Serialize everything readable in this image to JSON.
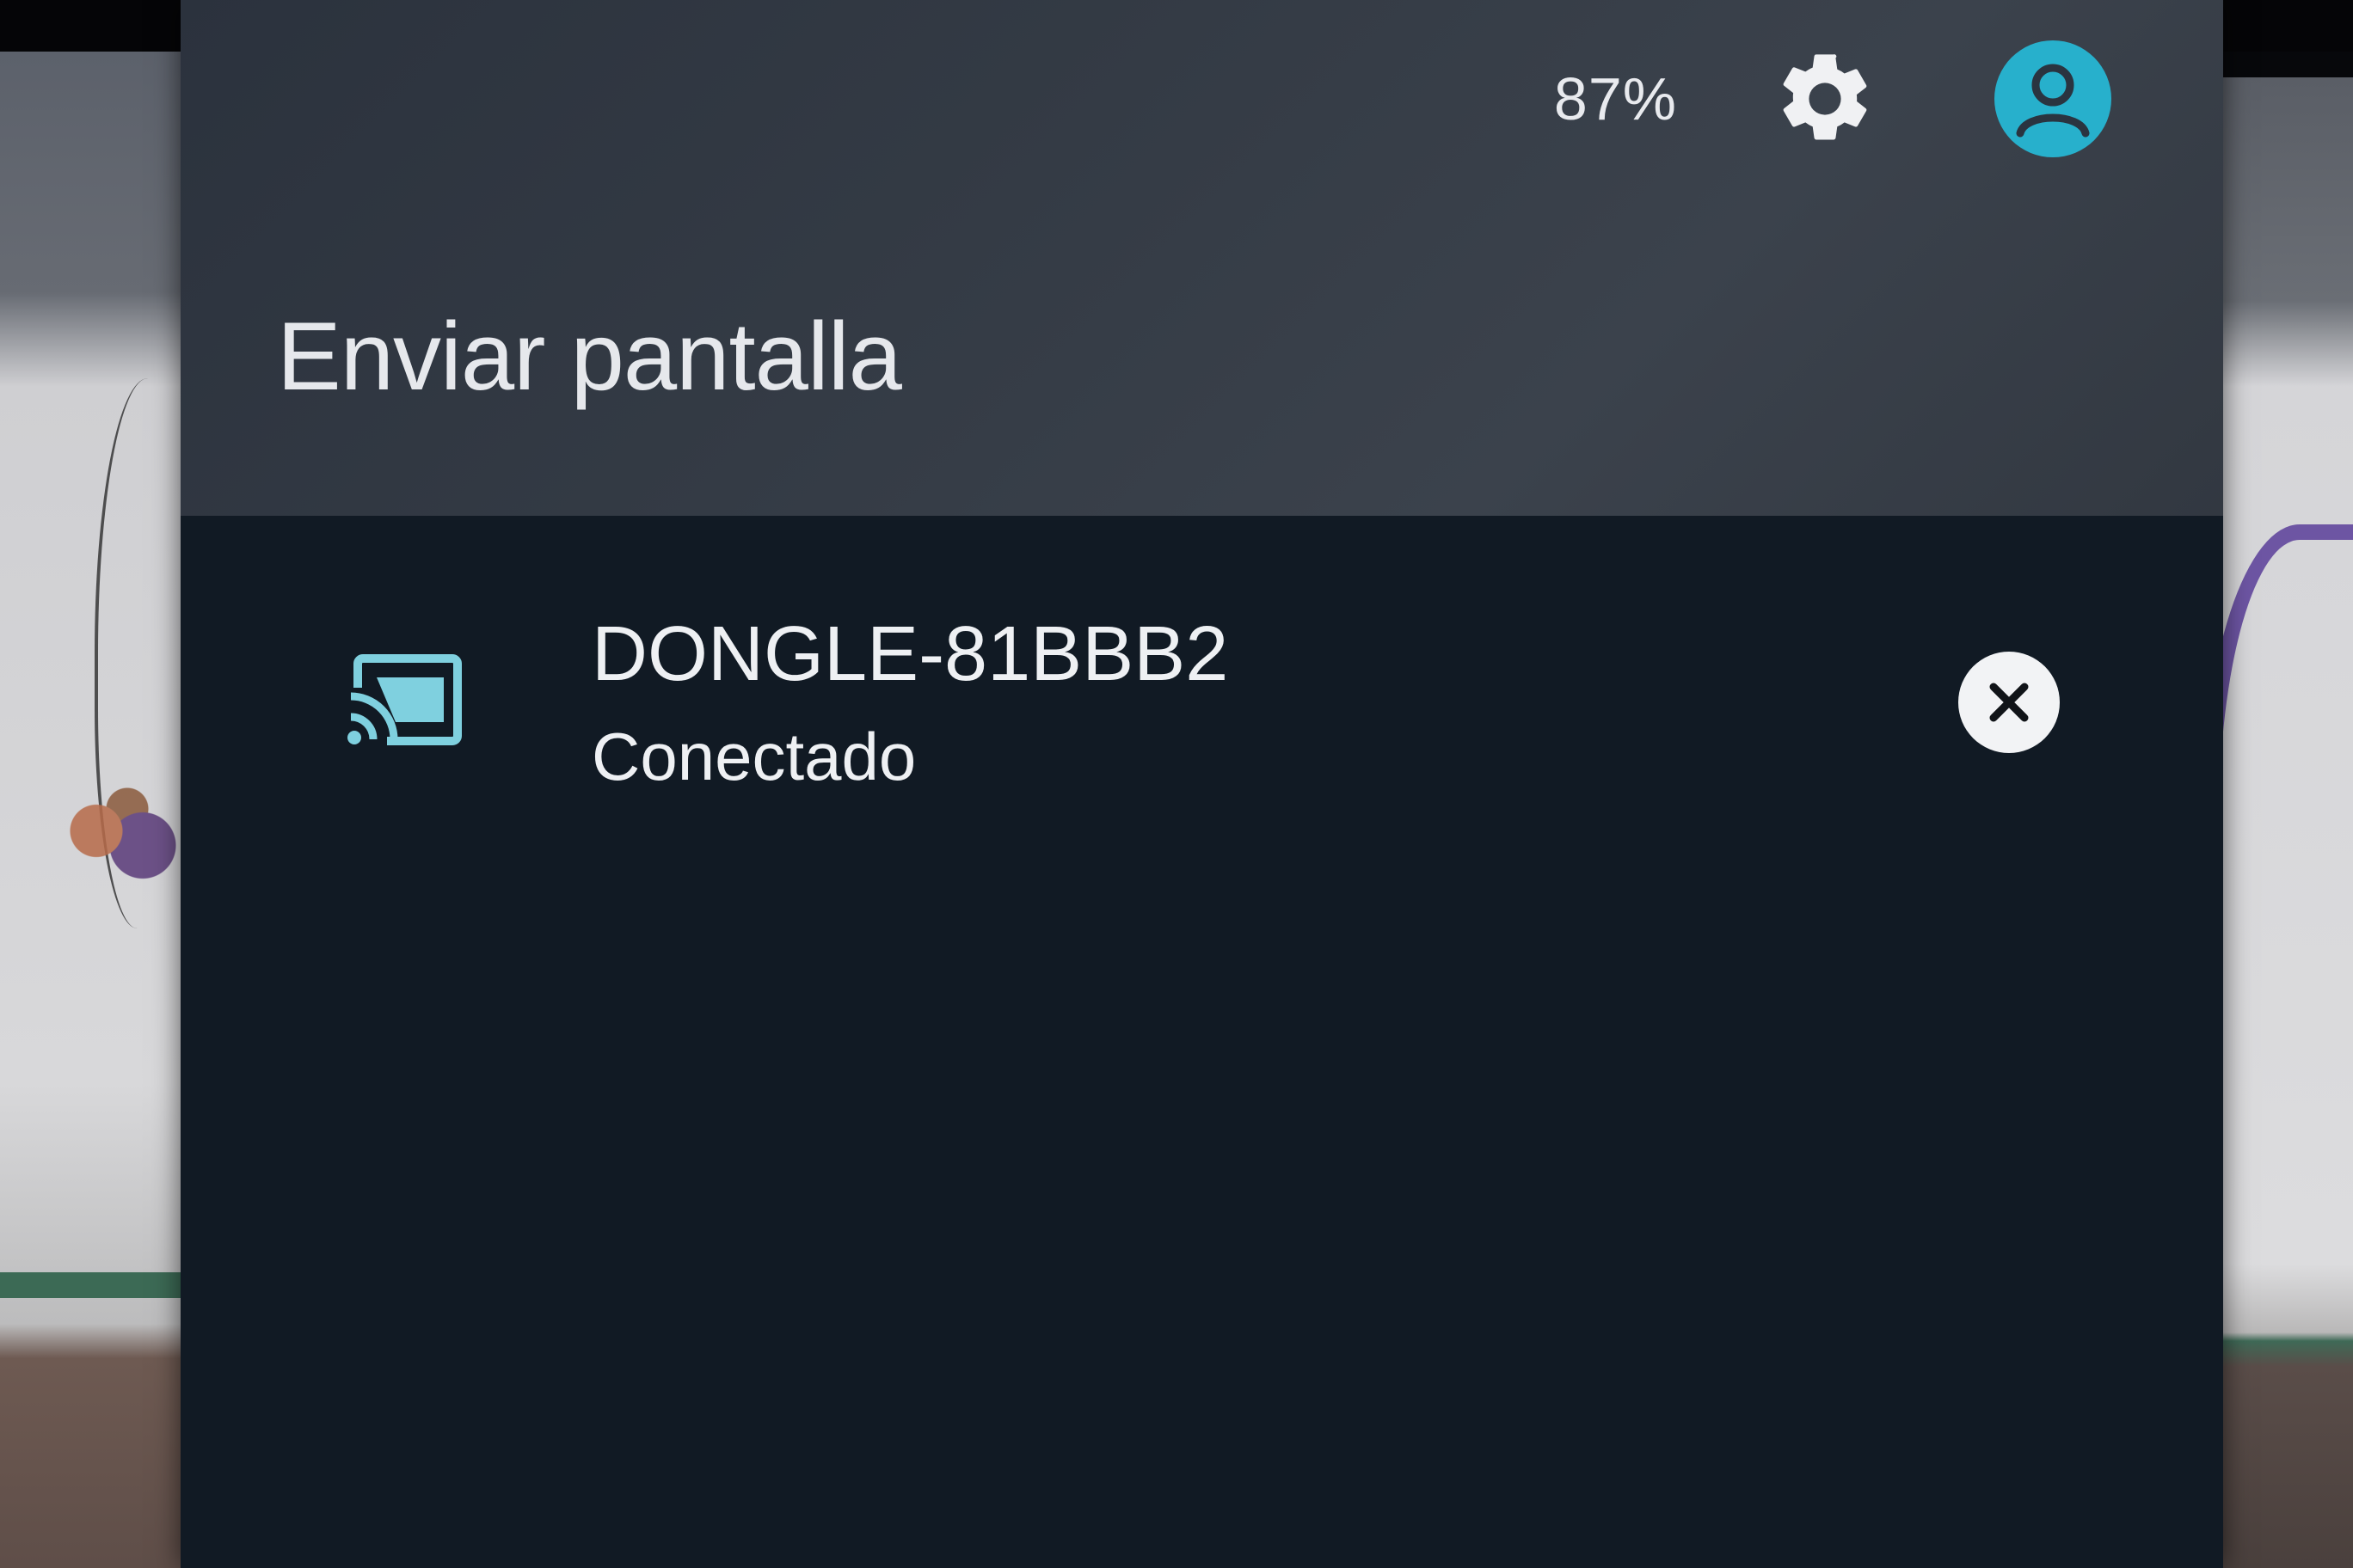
{
  "status_bar": {
    "battery_text": "87%",
    "settings_icon": "gear-icon",
    "account_icon": "account-circle-icon"
  },
  "dialog": {
    "title": "Enviar pantalla"
  },
  "devices": [
    {
      "name": "DONGLE-81BBB2",
      "status": "Conectado",
      "icon": "cast-connected-icon",
      "action_icon": "close-icon"
    }
  ],
  "colors": {
    "accent": "#27b0cc",
    "cast_icon": "#7fd0df",
    "panel_bg": "#111a24",
    "header_bg": "#353c46",
    "text": "#eef0f3"
  }
}
